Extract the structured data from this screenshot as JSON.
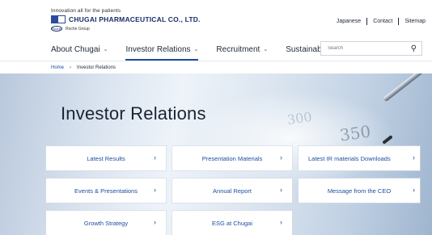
{
  "header": {
    "tagline": "Innovation all for the patients",
    "company": "CHUGAI PHARMACEUTICAL CO., LTD.",
    "group": "Roche Group",
    "logo_mark": "Roche",
    "util_links": [
      "Japanese",
      "Contact",
      "Sitemap"
    ],
    "nav": [
      {
        "label": "About Chugai",
        "active": false
      },
      {
        "label": "Investor Relations",
        "active": true
      },
      {
        "label": "Recruitment",
        "active": false
      },
      {
        "label": "Sustainability",
        "active": false
      }
    ],
    "search_placeholder": "Search"
  },
  "breadcrumb": {
    "home": "Home",
    "separator": "›",
    "current": "Investor Relations"
  },
  "hero": {
    "title": "Investor Relations",
    "background_digits": [
      "350",
      "300"
    ]
  },
  "tiles": [
    {
      "label": "Latest Results",
      "arrow": "›"
    },
    {
      "label": "Presentation Materials",
      "arrow": "›"
    },
    {
      "label": "Latest IR materials Downloads",
      "arrow": "›"
    },
    {
      "label": "Events & Presentations",
      "arrow": "›"
    },
    {
      "label": "Annual Report",
      "arrow": "›"
    },
    {
      "label": "Message from the CEO",
      "arrow": "›"
    },
    {
      "label": "Growth Strategy",
      "arrow": "›"
    },
    {
      "label": "ESG at Chugai",
      "arrow": "›"
    }
  ],
  "colors": {
    "brand_navy": "#1b2f6b",
    "link_blue": "#1b4fa0",
    "text_dark": "#1f2a3a"
  }
}
